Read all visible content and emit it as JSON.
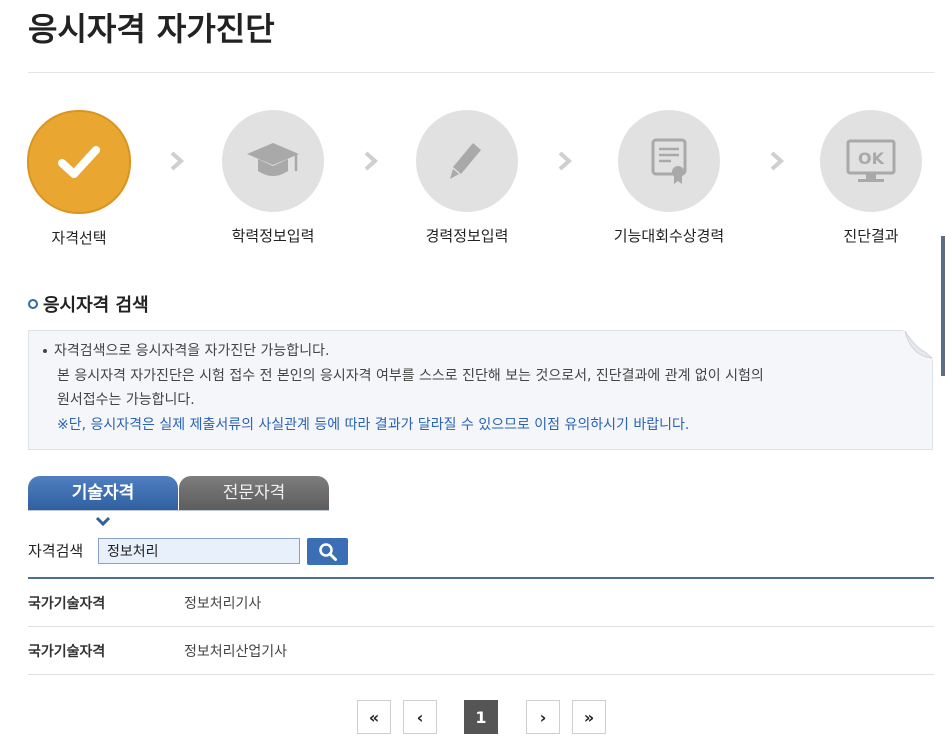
{
  "page": {
    "title": "응시자격 자가진단"
  },
  "steps": [
    {
      "label": "자격선택",
      "icon": "check-icon",
      "active": true
    },
    {
      "label": "학력정보입력",
      "icon": "graduation-cap-icon",
      "active": false
    },
    {
      "label": "경력정보입력",
      "icon": "pencil-icon",
      "active": false
    },
    {
      "label": "기능대회수상경력",
      "icon": "certificate-icon",
      "active": false
    },
    {
      "label": "진단결과",
      "icon": "monitor-ok-icon",
      "active": false
    }
  ],
  "section": {
    "title": "응시자격 검색"
  },
  "notice": {
    "line1": "자격검색으로 응시자격을 자가진단 가능합니다.",
    "line2": "본 응시자격 자가진단은 시험 접수 전 본인의 응시자격 여부를 스스로 진단해 보는 것으로서, 진단결과에 관계 없이 시험의",
    "line3": "원서접수는 가능합니다.",
    "warning": "※단, 응시자격은 실제 제출서류의 사실관계 등에 따라 결과가 달라질 수 있으므로 이점 유의하시기 바랍니다."
  },
  "tabs": [
    {
      "label": "기술자격",
      "active": true
    },
    {
      "label": "전문자격",
      "active": false
    }
  ],
  "search": {
    "label": "자격검색",
    "value": "정보처리",
    "button_icon": "search-icon"
  },
  "results": [
    {
      "category": "국가기술자격",
      "name": "정보처리기사"
    },
    {
      "category": "국가기술자격",
      "name": "정보처리산업기사"
    }
  ],
  "pagination": {
    "first": "«",
    "prev": "‹",
    "current": "1",
    "next": "›",
    "last": "»"
  },
  "colors": {
    "active_step": "#e9a732",
    "inactive_step": "#e1e1e1",
    "primary": "#3a6fb5",
    "tab_inactive": "#6a6a6a"
  }
}
